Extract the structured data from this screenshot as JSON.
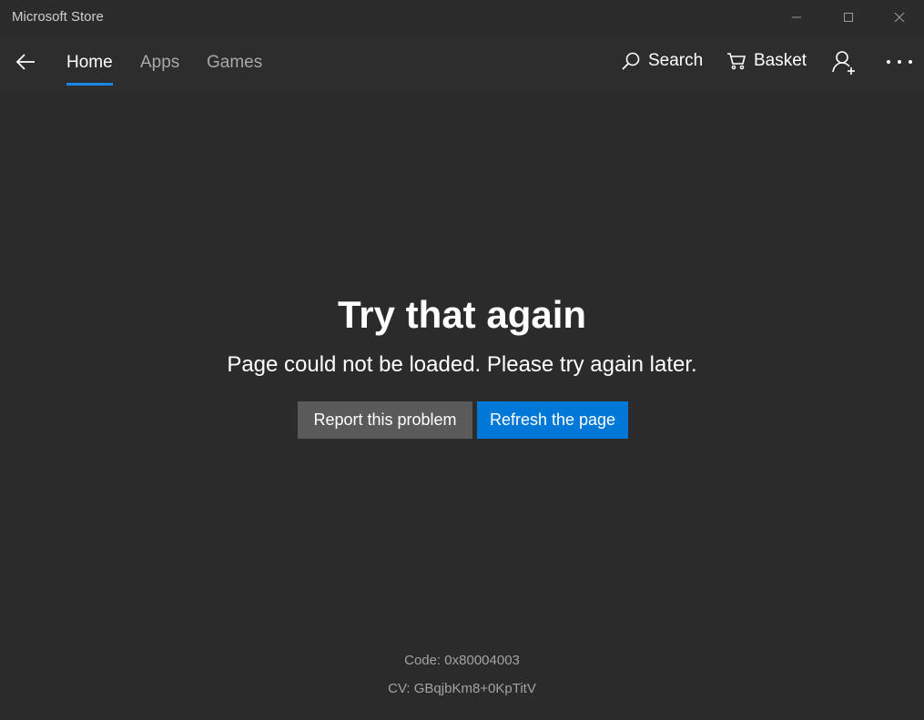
{
  "window": {
    "title": "Microsoft Store",
    "controls": {
      "minimize_icon": "minimize-icon",
      "maximize_icon": "maximize-icon",
      "close_icon": "close-icon"
    }
  },
  "nav": {
    "back_icon": "back-arrow-icon",
    "tabs": [
      {
        "label": "Home",
        "active": true
      },
      {
        "label": "Apps",
        "active": false
      },
      {
        "label": "Games",
        "active": false
      }
    ],
    "search_label": "Search",
    "basket_label": "Basket",
    "account_icon": "add-account-icon",
    "more_icon": "more-ellipsis-icon",
    "accent_color": "#0078d7"
  },
  "error": {
    "title": "Try that again",
    "message": "Page could not be loaded. Please try again later.",
    "report_button": "Report this problem",
    "refresh_button": "Refresh the page",
    "code": "Code: 0x80004003",
    "cv": "CV: GBqjbKm8+0KpTitV"
  }
}
